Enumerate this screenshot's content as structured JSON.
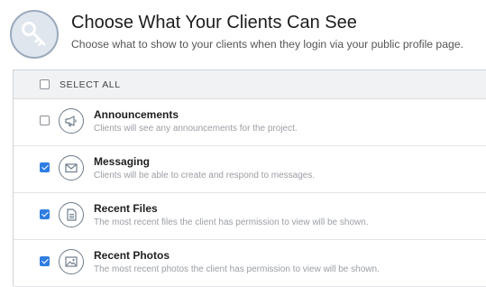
{
  "header": {
    "icon": "key-icon",
    "title": "Choose What Your Clients Can See",
    "subtitle": "Choose what to show to your clients when they login via your public profile page."
  },
  "select_all": {
    "label": "SELECT ALL",
    "checked": false
  },
  "items": [
    {
      "icon": "megaphone-icon",
      "title": "Announcements",
      "description": "Clients will see any announcements for the project.",
      "checked": false
    },
    {
      "icon": "envelope-icon",
      "title": "Messaging",
      "description": "Clients will be able to create and respond to messages.",
      "checked": true
    },
    {
      "icon": "document-icon",
      "title": "Recent Files",
      "description": "The most recent files the client has permission to view will be shown.",
      "checked": true
    },
    {
      "icon": "photo-icon",
      "title": "Recent Photos",
      "description": "The most recent photos the client has permission to view will be shown.",
      "checked": true
    }
  ],
  "colors": {
    "accent": "#2f7de1",
    "icon_stroke": "#6f7d8c"
  }
}
